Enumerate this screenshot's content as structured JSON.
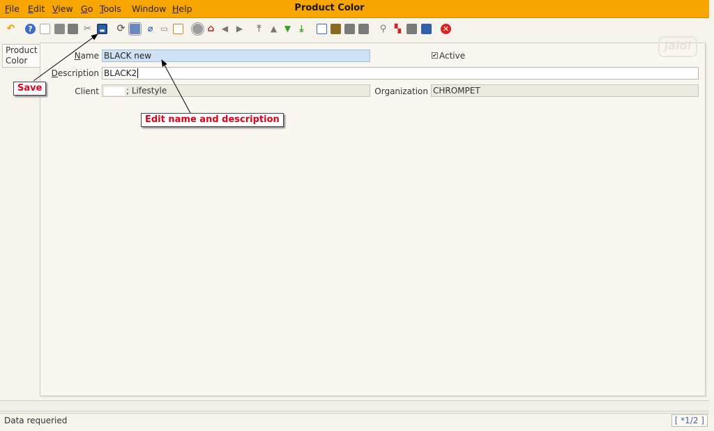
{
  "window": {
    "title": "Product Color"
  },
  "menu": [
    {
      "first": "F",
      "rest": "ile"
    },
    {
      "first": "E",
      "rest": "dit"
    },
    {
      "first": "V",
      "rest": "iew"
    },
    {
      "first": "G",
      "rest": "o"
    },
    {
      "first": "T",
      "rest": "ools"
    },
    {
      "first": "",
      "rest": "Window"
    },
    {
      "first": "H",
      "rest": "elp"
    }
  ],
  "toolbar": {
    "icons": [
      "undo-icon",
      "help-icon",
      "new-icon",
      "copy-icon",
      "delete-icon",
      "delete-selection-icon",
      "save-icon",
      "refresh-icon",
      "find-icon",
      "attachment-icon",
      "chat-icon",
      "grid-toggle-icon",
      "history-icon",
      "home-icon",
      "back-icon",
      "forward-icon",
      "first-record-icon",
      "previous-record-icon",
      "next-record-icon",
      "last-record-icon",
      "report-icon",
      "archive-icon",
      "print-preview-icon",
      "print-icon",
      "zoom-across-icon",
      "active-workflows-icon",
      "requests-icon",
      "product-info-icon",
      "exit-icon"
    ]
  },
  "tab": {
    "label_line1": "Product",
    "label_line2": "Color"
  },
  "form": {
    "name_label_first": "N",
    "name_label_rest": "ame",
    "name_value": "BLACK new",
    "description_label_first": "D",
    "description_label_rest": "escription",
    "description_value": "BLACK2",
    "client_label": "Client",
    "client_value": "; Lifestyle",
    "organization_label": "Organization",
    "organization_value": "CHROMPET",
    "active_label": "Active",
    "active_checked": true
  },
  "annotations": {
    "save_label": "Save",
    "edit_label": "Edit name and description"
  },
  "watermark": {
    "text": "jaldi"
  },
  "status": {
    "message": "Data requeried",
    "record_info": "[ *1/2 ]"
  },
  "colors": {
    "menubar": "#f7a600",
    "callout_text": "#e2001a",
    "name_field": "#cfe2f5"
  }
}
